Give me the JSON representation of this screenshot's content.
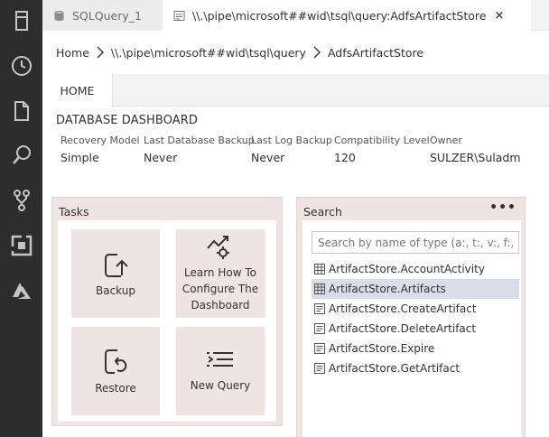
{
  "activity_bar": {
    "background": "#2d2d2d",
    "icons": [
      "servers-icon",
      "history-icon",
      "file-icon",
      "search-icon",
      "source-control-icon",
      "extensions-icon",
      "azure-icon"
    ]
  },
  "tabs": [
    {
      "label": "SQLQuery_1",
      "icon": "database-icon",
      "active": false
    },
    {
      "label": "\\\\.\\pipe\\microsoft##wid\\tsql\\query:AdfsArtifactStore",
      "icon": "dashboard-icon",
      "active": true,
      "close": "×"
    }
  ],
  "breadcrumb": {
    "items": [
      "Home",
      "\\\\.\\pipe\\microsoft##wid\\tsql\\query",
      "AdfsArtifactStore"
    ]
  },
  "ribbon": {
    "tab_label": "HOME"
  },
  "dashboard": {
    "title": "DATABASE DASHBOARD",
    "properties": [
      {
        "label": "Recovery Model",
        "value": "Simple"
      },
      {
        "label": "Last Database Backup",
        "value": "Never"
      },
      {
        "label": "Last Log Backup",
        "value": "Never"
      },
      {
        "label": "Compatibility Level",
        "value": "120"
      },
      {
        "label": "Owner",
        "value": "SULZER\\Suladm"
      }
    ]
  },
  "tasks_widget": {
    "title": "Tasks",
    "tasks": [
      {
        "label": "Backup",
        "icon": "backup-icon"
      },
      {
        "label": "Learn How To Configure The Dashboard",
        "icon": "configure-dashboard-icon"
      },
      {
        "label": "Restore",
        "icon": "restore-icon"
      },
      {
        "label": "New Query",
        "icon": "new-query-icon"
      }
    ]
  },
  "search_widget": {
    "title": "Search",
    "more": "•••",
    "placeholder": "Search by name of type (a:, t:, v:, f:, o...",
    "objects": [
      {
        "name": "ArtifactStore.AccountActivity",
        "icon": "table-icon",
        "selected": false
      },
      {
        "name": "ArtifactStore.Artifacts",
        "icon": "table-icon",
        "selected": true
      },
      {
        "name": "ArtifactStore.CreateArtifact",
        "icon": "procedure-icon",
        "selected": false
      },
      {
        "name": "ArtifactStore.DeleteArtifact",
        "icon": "procedure-icon",
        "selected": false
      },
      {
        "name": "ArtifactStore.Expire",
        "icon": "procedure-icon",
        "selected": false
      },
      {
        "name": "ArtifactStore.GetArtifact",
        "icon": "procedure-icon",
        "selected": false
      }
    ]
  },
  "colors": {
    "widget_background": "#efe3e4",
    "selected_row": "#dcdde8",
    "activity_bar": "#2d2d2d"
  }
}
